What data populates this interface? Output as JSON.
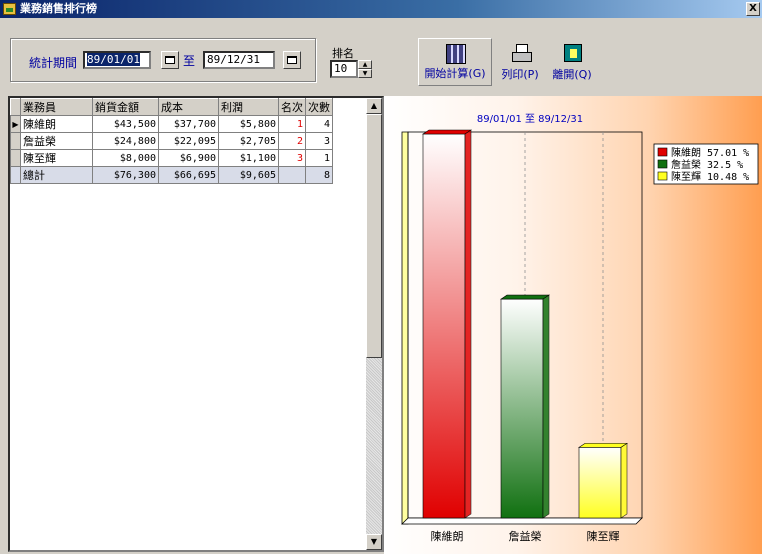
{
  "window": {
    "title": "業務銷售排行榜",
    "close_glyph": "X"
  },
  "filters": {
    "period_label": "統計期間",
    "date_from": "89/01/01",
    "to_label": "至",
    "date_to": "89/12/31",
    "rank_label": "排名",
    "rank_value": "10"
  },
  "toolbar": {
    "calc_label": "開始計算(G)",
    "print_label": "列印(P)",
    "exit_label": "離開(Q)"
  },
  "grid": {
    "headers": [
      "業務員",
      "銷貨金額",
      "成本",
      "利潤",
      "名次",
      "次數"
    ],
    "rows": [
      {
        "name": "陳維朗",
        "sales": "$43,500",
        "cost": "$37,700",
        "profit": "$5,800",
        "rank": "1",
        "count": "4"
      },
      {
        "name": "詹益榮",
        "sales": "$24,800",
        "cost": "$22,095",
        "profit": "$2,705",
        "rank": "2",
        "count": "3"
      },
      {
        "name": "陳至輝",
        "sales": "$8,000",
        "cost": "$6,900",
        "profit": "$1,100",
        "rank": "3",
        "count": "1"
      }
    ],
    "total": {
      "name": "總計",
      "sales": "$76,300",
      "cost": "$66,695",
      "profit": "$9,605",
      "rank": "",
      "count": "8"
    }
  },
  "chart_data": {
    "type": "bar",
    "title": "89/01/01 至 89/12/31",
    "categories": [
      "陳維朗",
      "詹益榮",
      "陳至輝"
    ],
    "values": [
      43500,
      24800,
      8000
    ],
    "colors": [
      "#e00000",
      "#107010",
      "#ffff20"
    ],
    "legend": [
      {
        "label": "陳維朗 57.01 %",
        "color": "#e00000"
      },
      {
        "label": "詹益榮 32.5 %",
        "color": "#107010"
      },
      {
        "label": "陳至輝 10.48 %",
        "color": "#ffff20"
      }
    ],
    "legend_position": "top-right",
    "ylim": [
      0,
      43500
    ],
    "grid": true
  }
}
